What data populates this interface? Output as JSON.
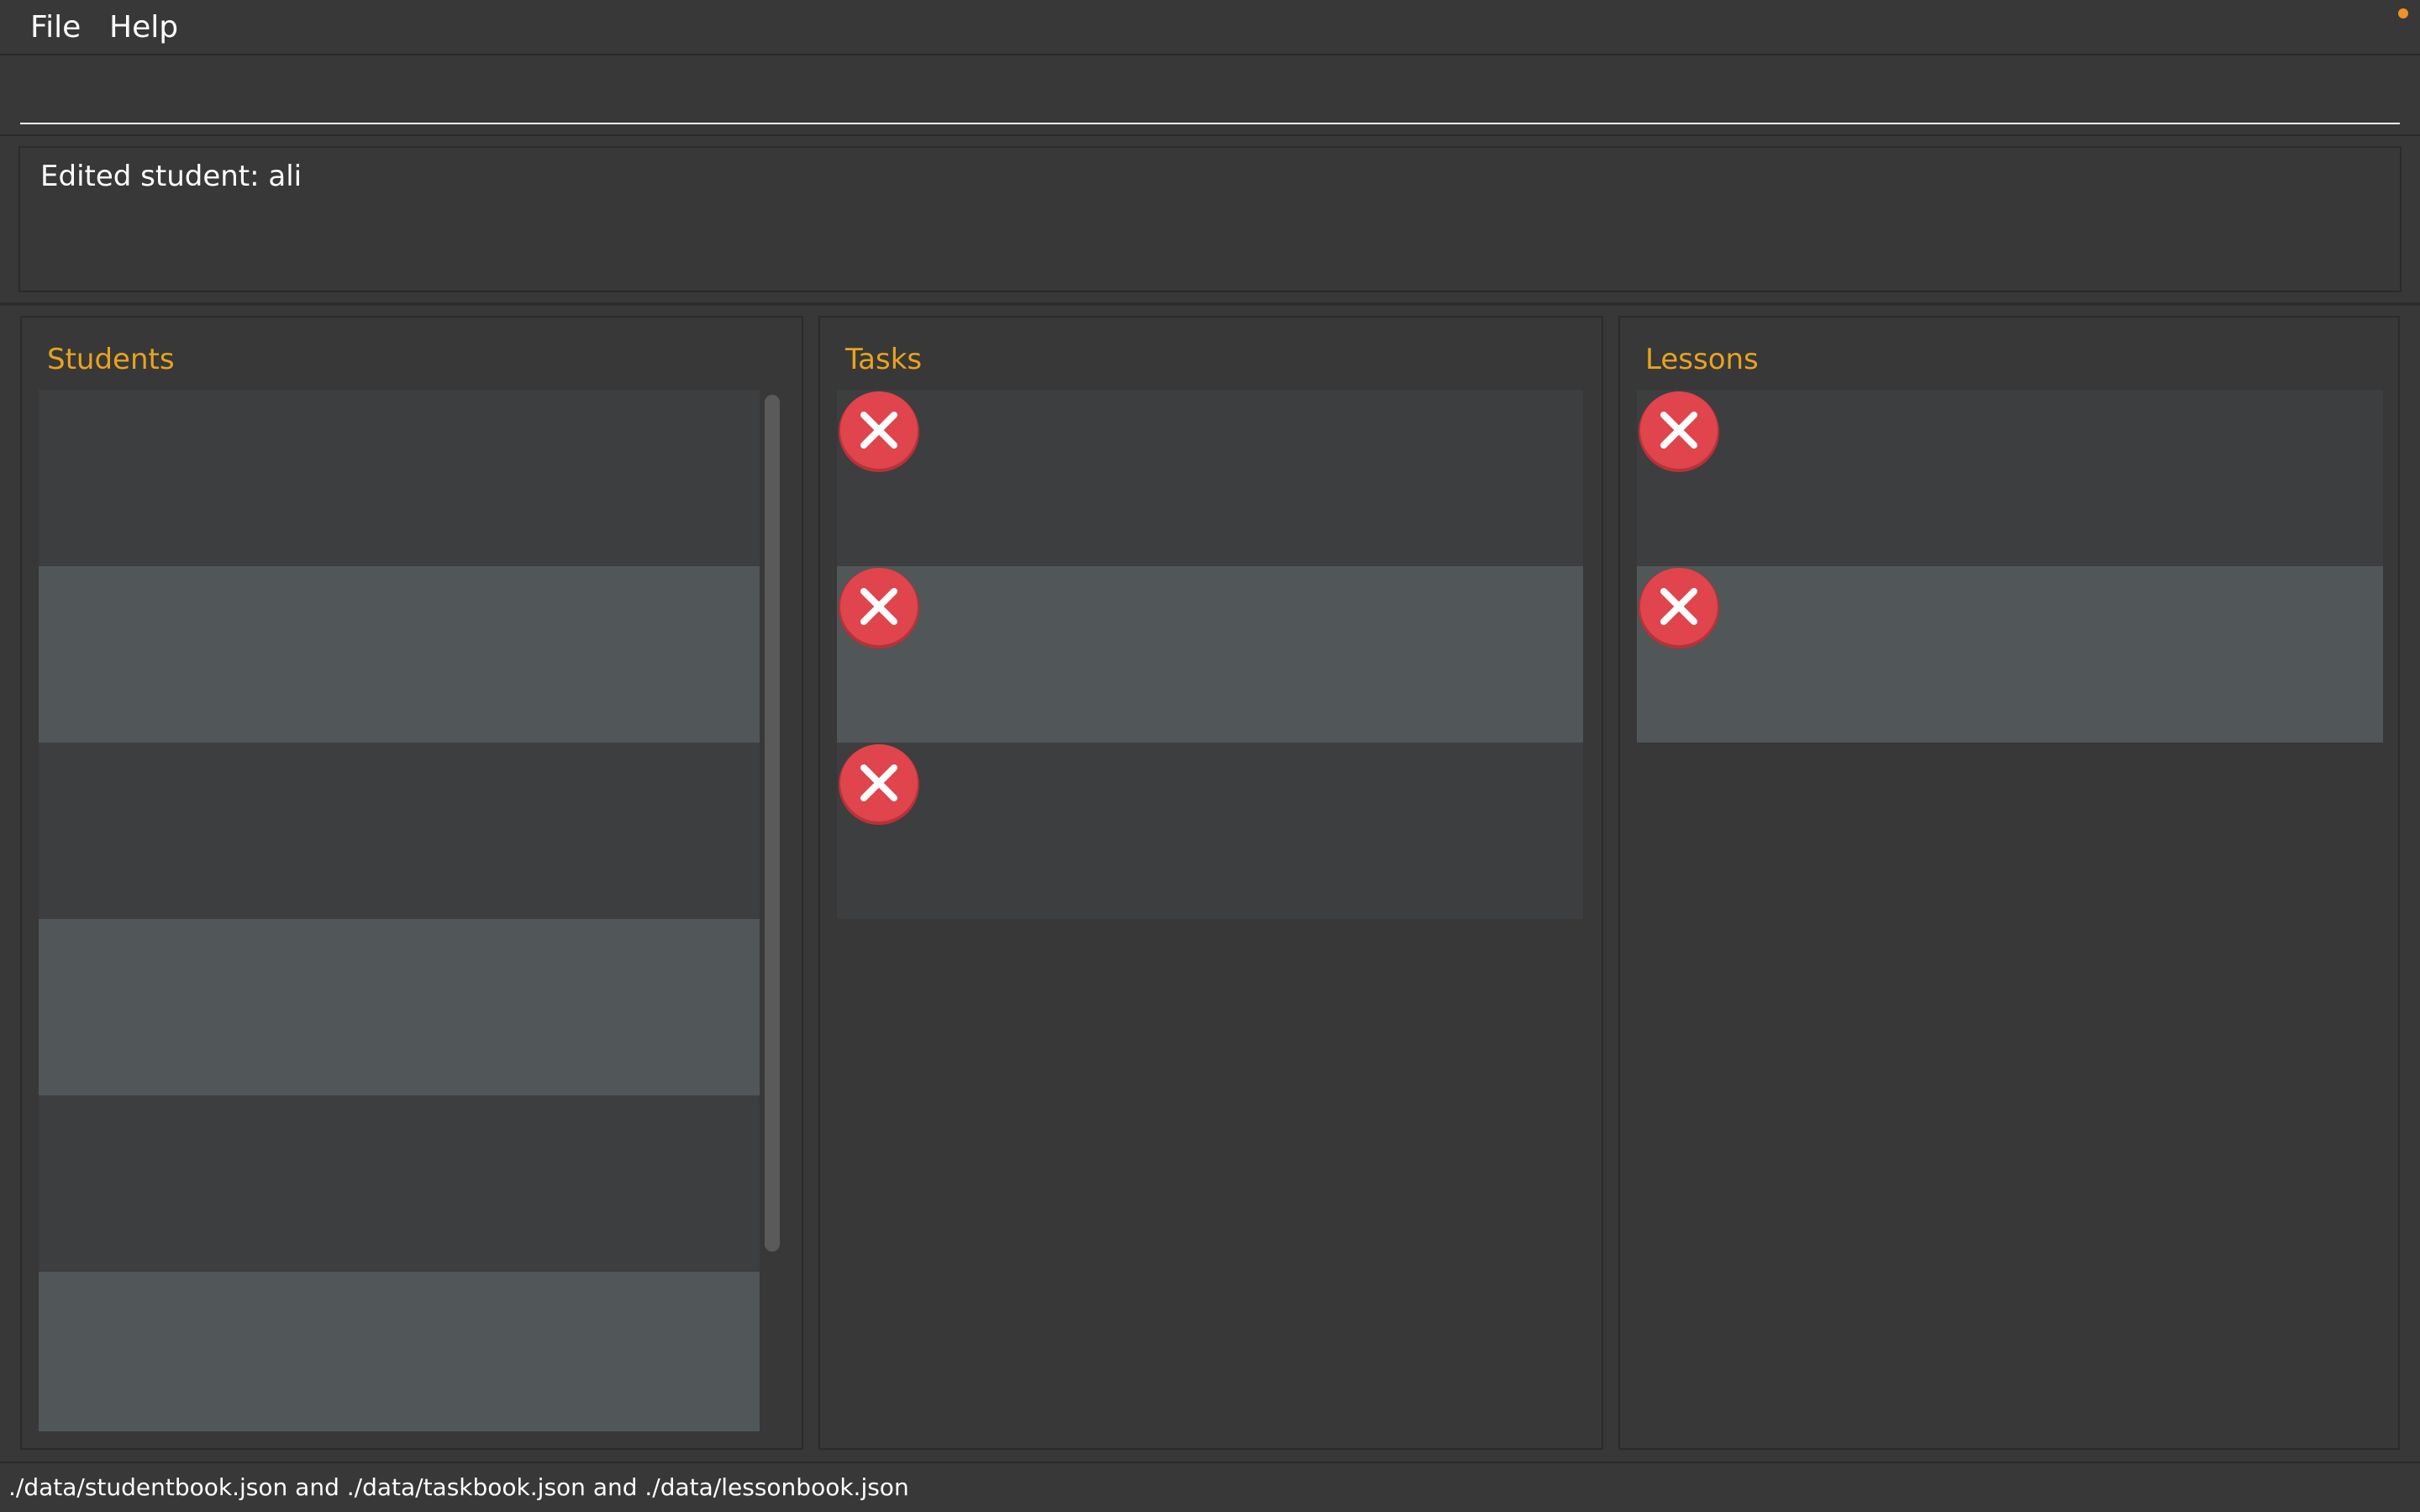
{
  "menu": {
    "file_label": "File",
    "help_label": "Help"
  },
  "command": {
    "value": "",
    "placeholder": ""
  },
  "result": {
    "text": "Edited student: ali"
  },
  "panels": {
    "students": {
      "title": "Students",
      "row_count_visible": 6
    },
    "tasks": {
      "title": "Tasks",
      "row_count": 3,
      "row_icon": "cross-circle-icon"
    },
    "lessons": {
      "title": "Lessons",
      "row_count": 2,
      "row_icon": "cross-circle-icon"
    }
  },
  "status": {
    "text": "./data/studentbook.json and ./data/taskbook.json and ./data/lessonbook.json"
  },
  "colors": {
    "background": "#383838",
    "accent_title": "#e8a31f",
    "row_dark": "#3c3e40",
    "row_light": "#515658",
    "icon_red": "#e0444c",
    "window_dot": "#f09028"
  }
}
